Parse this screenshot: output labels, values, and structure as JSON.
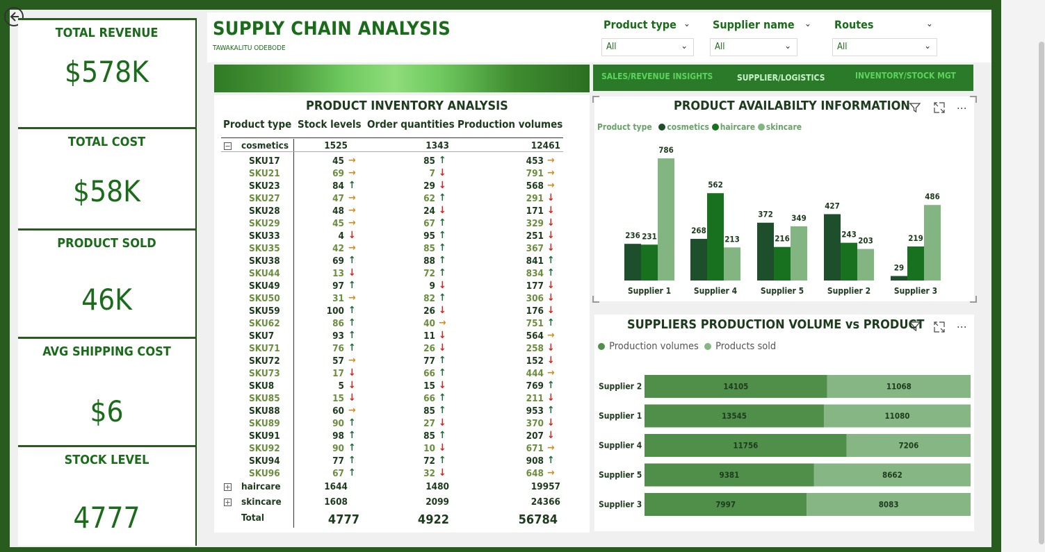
{
  "kpis": [
    {
      "title": "TOTAL REVENUE",
      "value": "$578K"
    },
    {
      "title": "TOTAL COST",
      "value": "$58K"
    },
    {
      "title": "PRODUCT SOLD",
      "value": "46K"
    },
    {
      "title": "AVG SHIPPING COST",
      "value": "$6"
    },
    {
      "title": "STOCK LEVEL",
      "value": "4777"
    }
  ],
  "header": {
    "title": "SUPPLY CHAIN ANALYSIS",
    "author": "TAWAKALITU ODEBODE"
  },
  "slicers": [
    {
      "label": "Product type",
      "value": "All"
    },
    {
      "label": "Supplier name",
      "value": "All"
    },
    {
      "label": "Routes",
      "value": "All"
    }
  ],
  "nav": [
    {
      "label": "SALES/REVENUE INSIGHTS"
    },
    {
      "label": "SUPPLIER/LOGISTICS"
    },
    {
      "label": "INVENTORY/STOCK MGT"
    }
  ],
  "inventory": {
    "title": "PRODUCT INVENTORY ANALYSIS",
    "columns": [
      "Product type",
      "Stock levels",
      "Order quantities",
      "Production volumes"
    ],
    "group": {
      "name": "cosmetics",
      "stock": "1525",
      "orders": "1343",
      "production": "12461"
    },
    "rows": [
      {
        "sku": "SKU17",
        "stock": "45",
        "sa": "flat",
        "orders": "85",
        "oa": "up",
        "prod": "453",
        "pa": "flat"
      },
      {
        "sku": "SKU21",
        "stock": "69",
        "sa": "flat",
        "orders": "7",
        "oa": "down",
        "prod": "791",
        "pa": "flat"
      },
      {
        "sku": "SKU23",
        "stock": "84",
        "sa": "up",
        "orders": "29",
        "oa": "down",
        "prod": "568",
        "pa": "flat"
      },
      {
        "sku": "SKU27",
        "stock": "47",
        "sa": "flat",
        "orders": "62",
        "oa": "up",
        "prod": "291",
        "pa": "down"
      },
      {
        "sku": "SKU28",
        "stock": "48",
        "sa": "flat",
        "orders": "24",
        "oa": "down",
        "prod": "171",
        "pa": "down"
      },
      {
        "sku": "SKU29",
        "stock": "45",
        "sa": "flat",
        "orders": "67",
        "oa": "up",
        "prod": "329",
        "pa": "down"
      },
      {
        "sku": "SKU33",
        "stock": "4",
        "sa": "down",
        "orders": "95",
        "oa": "up",
        "prod": "251",
        "pa": "down"
      },
      {
        "sku": "SKU35",
        "stock": "42",
        "sa": "flat",
        "orders": "85",
        "oa": "up",
        "prod": "367",
        "pa": "down"
      },
      {
        "sku": "SKU38",
        "stock": "69",
        "sa": "up",
        "orders": "88",
        "oa": "up",
        "prod": "841",
        "pa": "up"
      },
      {
        "sku": "SKU44",
        "stock": "13",
        "sa": "down",
        "orders": "72",
        "oa": "up",
        "prod": "834",
        "pa": "up"
      },
      {
        "sku": "SKU49",
        "stock": "97",
        "sa": "up",
        "orders": "9",
        "oa": "down",
        "prod": "177",
        "pa": "down"
      },
      {
        "sku": "SKU50",
        "stock": "31",
        "sa": "flat",
        "orders": "82",
        "oa": "up",
        "prod": "306",
        "pa": "down"
      },
      {
        "sku": "SKU59",
        "stock": "100",
        "sa": "up",
        "orders": "26",
        "oa": "down",
        "prod": "176",
        "pa": "down"
      },
      {
        "sku": "SKU62",
        "stock": "86",
        "sa": "up",
        "orders": "40",
        "oa": "flat",
        "prod": "751",
        "pa": "up"
      },
      {
        "sku": "SKU7",
        "stock": "93",
        "sa": "up",
        "orders": "11",
        "oa": "down",
        "prod": "564",
        "pa": "flat"
      },
      {
        "sku": "SKU71",
        "stock": "76",
        "sa": "up",
        "orders": "26",
        "oa": "down",
        "prod": "258",
        "pa": "down"
      },
      {
        "sku": "SKU72",
        "stock": "57",
        "sa": "flat",
        "orders": "77",
        "oa": "up",
        "prod": "152",
        "pa": "down"
      },
      {
        "sku": "SKU73",
        "stock": "17",
        "sa": "down",
        "orders": "66",
        "oa": "up",
        "prod": "444",
        "pa": "flat"
      },
      {
        "sku": "SKU8",
        "stock": "5",
        "sa": "down",
        "orders": "15",
        "oa": "down",
        "prod": "769",
        "pa": "up"
      },
      {
        "sku": "SKU85",
        "stock": "15",
        "sa": "down",
        "orders": "66",
        "oa": "up",
        "prod": "211",
        "pa": "down"
      },
      {
        "sku": "SKU88",
        "stock": "60",
        "sa": "flat",
        "orders": "85",
        "oa": "up",
        "prod": "953",
        "pa": "up"
      },
      {
        "sku": "SKU89",
        "stock": "90",
        "sa": "up",
        "orders": "27",
        "oa": "down",
        "prod": "370",
        "pa": "down"
      },
      {
        "sku": "SKU91",
        "stock": "98",
        "sa": "up",
        "orders": "85",
        "oa": "up",
        "prod": "207",
        "pa": "down"
      },
      {
        "sku": "SKU92",
        "stock": "90",
        "sa": "up",
        "orders": "10",
        "oa": "down",
        "prod": "671",
        "pa": "flat"
      },
      {
        "sku": "SKU94",
        "stock": "77",
        "sa": "up",
        "orders": "72",
        "oa": "up",
        "prod": "908",
        "pa": "up"
      },
      {
        "sku": "SKU96",
        "stock": "67",
        "sa": "up",
        "orders": "32",
        "oa": "down",
        "prod": "648",
        "pa": "flat"
      }
    ],
    "collapsed": [
      {
        "name": "haircare",
        "stock": "1644",
        "orders": "1480",
        "production": "19957"
      },
      {
        "name": "skincare",
        "stock": "1608",
        "orders": "2099",
        "production": "24366"
      }
    ],
    "total": {
      "label": "Total",
      "stock": "4777",
      "orders": "4922",
      "production": "56784"
    }
  },
  "chart_data": [
    {
      "type": "bar",
      "title": "PRODUCT AVAILABILTY INFORMATION",
      "legend_title": "Product type",
      "categories": [
        "Supplier 1",
        "Supplier 4",
        "Supplier 5",
        "Supplier 2",
        "Supplier 3"
      ],
      "series": [
        {
          "name": "cosmetics",
          "color": "#1d4f2d",
          "values": [
            236,
            268,
            372,
            427,
            29
          ]
        },
        {
          "name": "haircare",
          "color": "#17711f",
          "values": [
            231,
            562,
            216,
            243,
            219
          ]
        },
        {
          "name": "skincare",
          "color": "#82b582",
          "values": [
            786,
            213,
            349,
            203,
            486
          ]
        }
      ],
      "ylim": [
        0,
        800
      ]
    },
    {
      "type": "bar",
      "orientation": "horizontal-stacked",
      "title": "SUPPLIERS PRODUCTION VOLUME vs PRODUCT",
      "categories": [
        "Supplier 2",
        "Supplier 1",
        "Supplier 4",
        "Supplier 5",
        "Supplier 3"
      ],
      "series": [
        {
          "name": "Production volumes",
          "color": "#4f8f4a",
          "values": [
            14105,
            13545,
            11756,
            9381,
            7997
          ]
        },
        {
          "name": "Products sold",
          "color": "#86b683",
          "values": [
            11068,
            11080,
            7206,
            8662,
            8083
          ]
        }
      ]
    }
  ],
  "icons": {
    "back": "back-arrow-icon",
    "filter": "filter-icon",
    "focus": "focus-mode-icon",
    "more": "more-options-icon"
  }
}
